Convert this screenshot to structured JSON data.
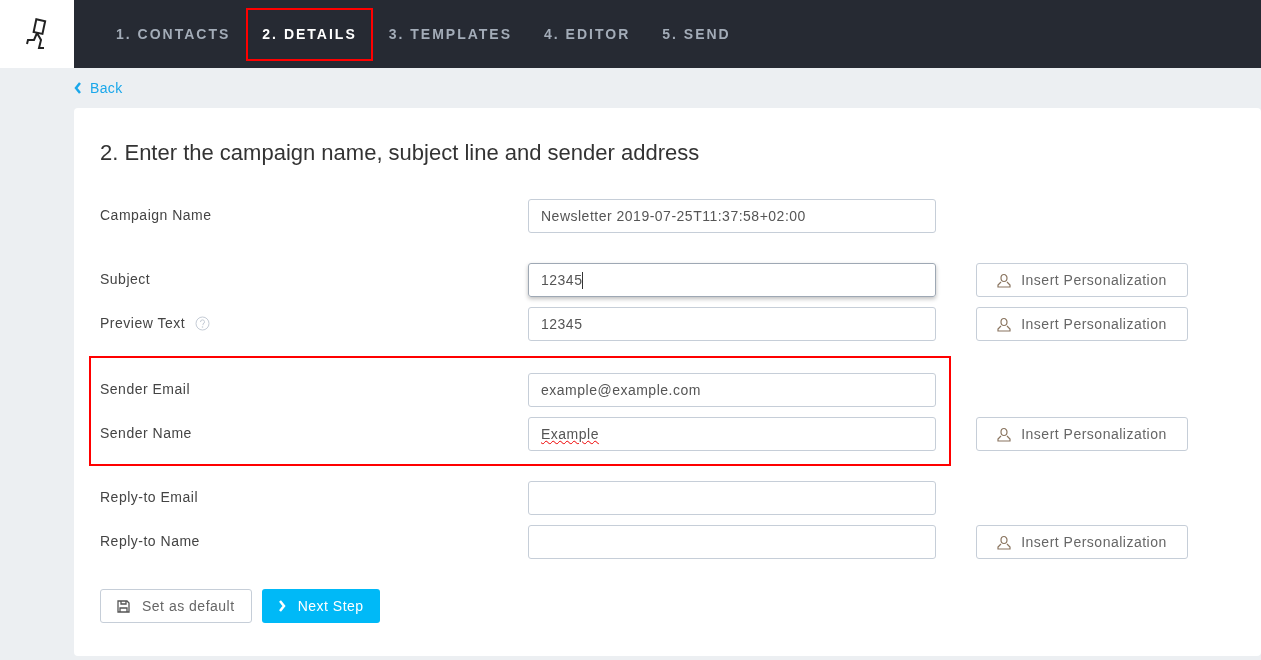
{
  "steps": [
    {
      "label": "1. CONTACTS",
      "selected": false,
      "highlighted": false
    },
    {
      "label": "2. DETAILS",
      "selected": true,
      "highlighted": true
    },
    {
      "label": "3. TEMPLATES",
      "selected": false,
      "highlighted": false
    },
    {
      "label": "4. EDITOR",
      "selected": false,
      "highlighted": false
    },
    {
      "label": "5. SEND",
      "selected": false,
      "highlighted": false
    }
  ],
  "back_link": "Back",
  "form": {
    "title": "2. Enter the campaign name, subject line and sender address",
    "sections": [
      {
        "highlighted": false,
        "fields": [
          {
            "label": "Campaign Name",
            "value": "Newsletter 2019-07-25T11:37:58+02:00",
            "focused": false,
            "misspelled": false
          }
        ]
      },
      {
        "highlighted": false,
        "fields": [
          {
            "label": "Subject",
            "value": "12345",
            "focused": true,
            "misspelled": false,
            "button": "Insert Personalization"
          },
          {
            "label": "Preview Text",
            "help_icon": true,
            "value": "12345",
            "focused": false,
            "misspelled": false,
            "button": "Insert Personalization"
          }
        ]
      },
      {
        "highlighted": true,
        "fields": [
          {
            "label": "Sender Email",
            "value": "example@example.com",
            "focused": false,
            "misspelled": false
          },
          {
            "label": "Sender Name",
            "value": "Example",
            "focused": false,
            "misspelled": true,
            "button": "Insert Personalization"
          }
        ]
      },
      {
        "highlighted": false,
        "fields": [
          {
            "label": "Reply-to Email",
            "focused": false,
            "misspelled": false
          },
          {
            "label": "Reply-to Name",
            "focused": false,
            "misspelled": false,
            "button": "Insert Personalization"
          }
        ]
      }
    ],
    "buttons": [
      {
        "kind": "secondary",
        "label": "Set as default"
      },
      {
        "kind": "primary",
        "label": "Next Step"
      }
    ]
  }
}
